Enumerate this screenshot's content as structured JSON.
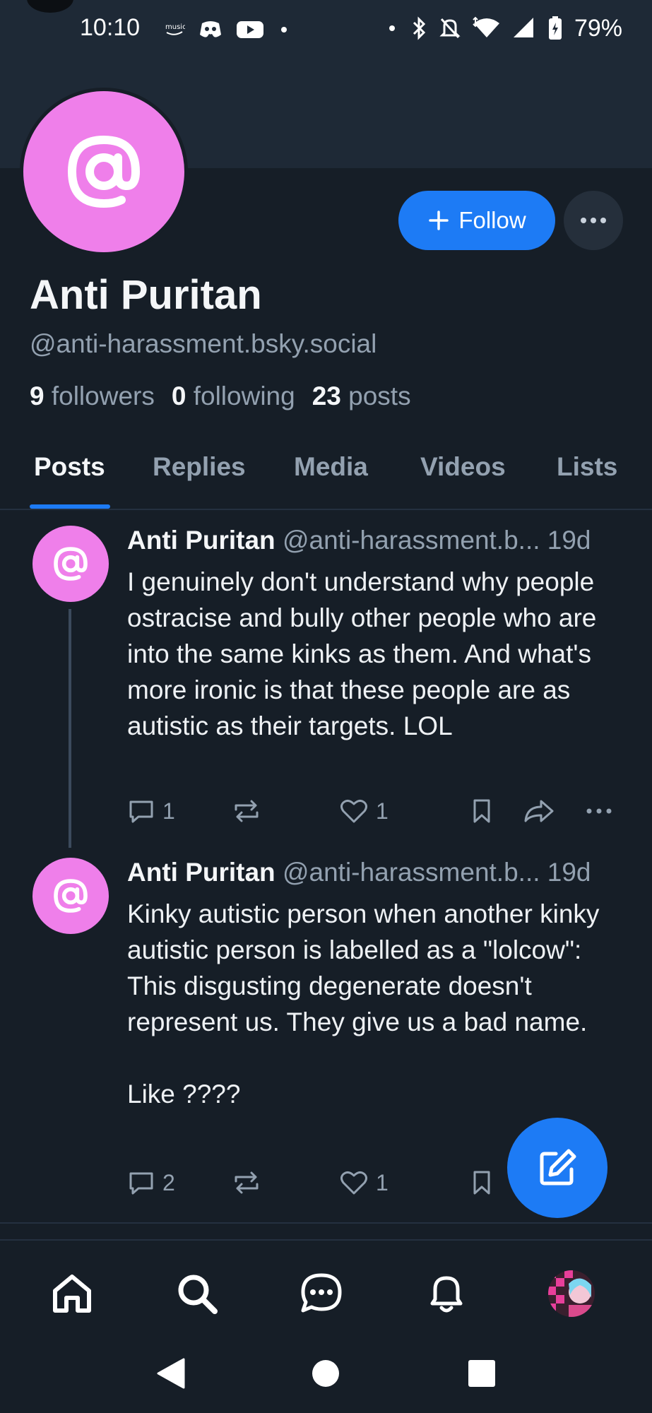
{
  "status_bar": {
    "time": "10:10",
    "battery": "79%",
    "left_icons": [
      "amazon-music-icon",
      "discord-icon",
      "youtube-icon",
      "dot-icon"
    ],
    "right_icons": [
      "dot-icon",
      "bluetooth-icon",
      "bell-off-icon",
      "wifi-icon",
      "signal-icon",
      "battery-charging-icon"
    ]
  },
  "profile": {
    "display_name": "Anti Puritan",
    "handle": "@anti-harassment.bsky.social",
    "followers_count": "9",
    "followers_label": "followers",
    "following_count": "0",
    "following_label": "following",
    "posts_count": "23",
    "posts_label": "posts",
    "follow_label": "Follow",
    "avatar_color": "#ef7fea"
  },
  "tabs": [
    {
      "label": "Posts",
      "active": true
    },
    {
      "label": "Replies",
      "active": false
    },
    {
      "label": "Media",
      "active": false
    },
    {
      "label": "Videos",
      "active": false
    },
    {
      "label": "Lists",
      "active": false
    }
  ],
  "posts": [
    {
      "author": "Anti Puritan",
      "handle": "@anti-harassment.b...",
      "date": "19d",
      "text": "I genuinely don't understand why people ostracise and bully other people who are into the same kinks as them. And what's more ironic is that these people are as autistic as their targets. LOL",
      "replies": "1",
      "reposts": "",
      "likes": "1"
    },
    {
      "author": "Anti Puritan",
      "handle": "@anti-harassment.b...",
      "date": "19d",
      "text": "Kinky autistic person when another kinky autistic person is labelled as a \"lolcow\": This disgusting degenerate doesn't represent us. They give us a bad name.\n\nLike ????",
      "replies": "2",
      "reposts": "",
      "likes": "1"
    }
  ],
  "colors": {
    "accent": "#1d7bf5",
    "background": "#161e27",
    "banner": "#1e2936",
    "muted_text": "#93a1b0"
  },
  "bottom_nav": [
    "home-icon",
    "search-icon",
    "chat-icon",
    "bell-icon",
    "profile-avatar"
  ]
}
